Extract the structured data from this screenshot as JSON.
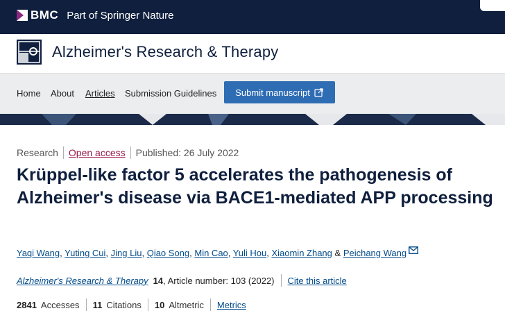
{
  "topbar": {
    "brand": "BMC",
    "tagline": "Part of Springer Nature"
  },
  "journal": {
    "title": "Alzheimer's Research & Therapy"
  },
  "nav": {
    "items": [
      "Home",
      "About",
      "Articles",
      "Submission Guidelines"
    ],
    "active": "Articles",
    "submit_label": "Submit manuscript"
  },
  "article": {
    "type": "Research",
    "access": "Open access",
    "published": "Published: 26 July 2022",
    "title": "Krüppel-like factor 5 accelerates the pathogenesis of Alzheimer's disease via BACE1-mediated APP processing",
    "authors": [
      "Yaqi Wang",
      "Yuting Cui",
      "Jing Liu",
      "Qiao Song",
      "Min Cao",
      "Yuli Hou",
      "Xiaomin Zhang",
      "Peichang Wang"
    ],
    "citation": {
      "journal": "Alzheimer's Research & Therapy",
      "volume": "14",
      "article_number": ", Article number: 103 (2022)",
      "cite_label": "Cite this article"
    },
    "metrics": {
      "accesses_value": "2841",
      "accesses_label": "Accesses",
      "citations_value": "11",
      "citations_label": "Citations",
      "altmetric_value": "10",
      "altmetric_label": "Altmetric",
      "metrics_link": "Metrics"
    }
  },
  "icons": {
    "bmc_logo": "bmc-logo-icon",
    "journal_logo": "journal-logo-icon",
    "external_link": "external-link-icon",
    "mail": "mail-icon"
  },
  "colors": {
    "topbar": "#0f1f3d",
    "nav_bg": "#ecedef",
    "submit_button": "#2e6db4",
    "open_access": "#9c1b4b",
    "link": "#024b8a",
    "title": "#0f1f3d"
  }
}
